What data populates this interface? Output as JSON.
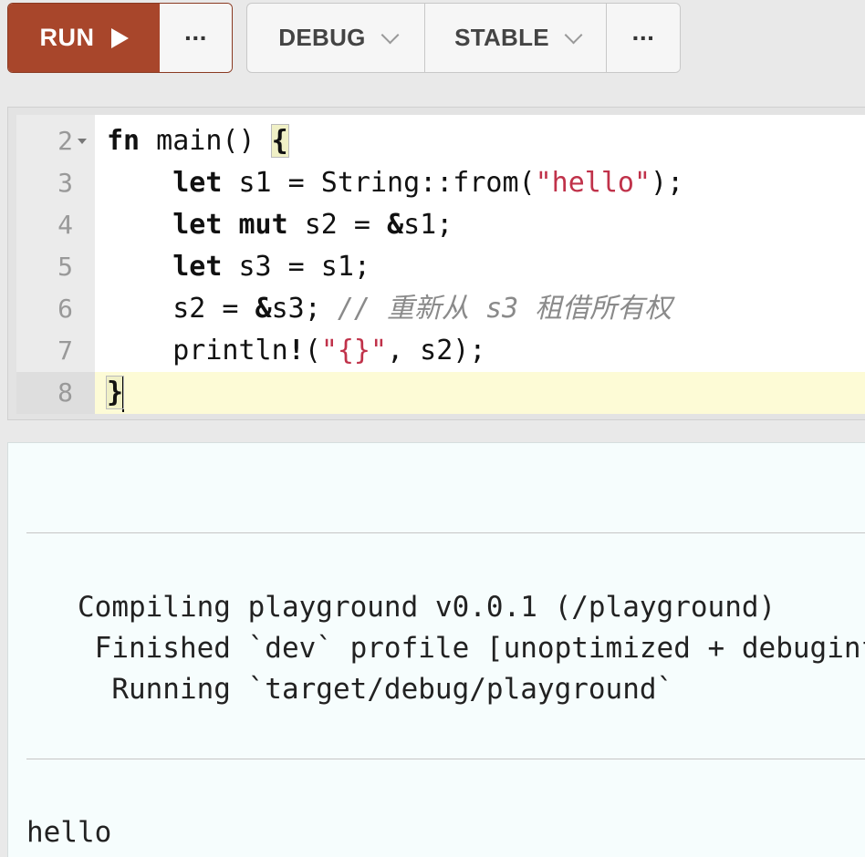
{
  "toolbar": {
    "run_label": "RUN",
    "more_label": "···",
    "mode_label": "DEBUG",
    "channel_label": "STABLE",
    "more2_label": "···"
  },
  "editor": {
    "lines": [
      {
        "num": "2",
        "segments": [
          {
            "t": "fn",
            "c": "kw"
          },
          {
            "t": " main() ",
            "c": ""
          },
          {
            "t": "{",
            "c": "brace"
          }
        ]
      },
      {
        "num": "3",
        "segments": [
          {
            "t": "    ",
            "c": ""
          },
          {
            "t": "let",
            "c": "kw"
          },
          {
            "t": " s1 = String::from(",
            "c": ""
          },
          {
            "t": "\"hello\"",
            "c": "str"
          },
          {
            "t": ");",
            "c": ""
          }
        ]
      },
      {
        "num": "4",
        "segments": [
          {
            "t": "    ",
            "c": ""
          },
          {
            "t": "let mut",
            "c": "kw"
          },
          {
            "t": " s2 = ",
            "c": ""
          },
          {
            "t": "&",
            "c": "kw"
          },
          {
            "t": "s1;",
            "c": ""
          }
        ]
      },
      {
        "num": "5",
        "segments": [
          {
            "t": "    ",
            "c": ""
          },
          {
            "t": "let",
            "c": "kw"
          },
          {
            "t": " s3 = s1;",
            "c": ""
          }
        ]
      },
      {
        "num": "6",
        "segments": [
          {
            "t": "    s2 = ",
            "c": ""
          },
          {
            "t": "&",
            "c": "kw"
          },
          {
            "t": "s3; ",
            "c": ""
          },
          {
            "t": "// 重新从 s3 租借所有权",
            "c": "cm"
          }
        ]
      },
      {
        "num": "7",
        "segments": [
          {
            "t": "    println",
            "c": ""
          },
          {
            "t": "!",
            "c": "kw"
          },
          {
            "t": "(",
            "c": ""
          },
          {
            "t": "\"{}\"",
            "c": "str"
          },
          {
            "t": ", s2);",
            "c": ""
          }
        ]
      },
      {
        "num": "8",
        "segments": [
          {
            "t": "}",
            "c": "brace"
          }
        ]
      }
    ]
  },
  "output": {
    "build_lines": [
      "   Compiling playground v0.0.1 (/playground)",
      "    Finished `dev` profile [unoptimized + debuginfo] target(s)",
      "     Running `target/debug/playground`"
    ],
    "stdout": "hello"
  }
}
